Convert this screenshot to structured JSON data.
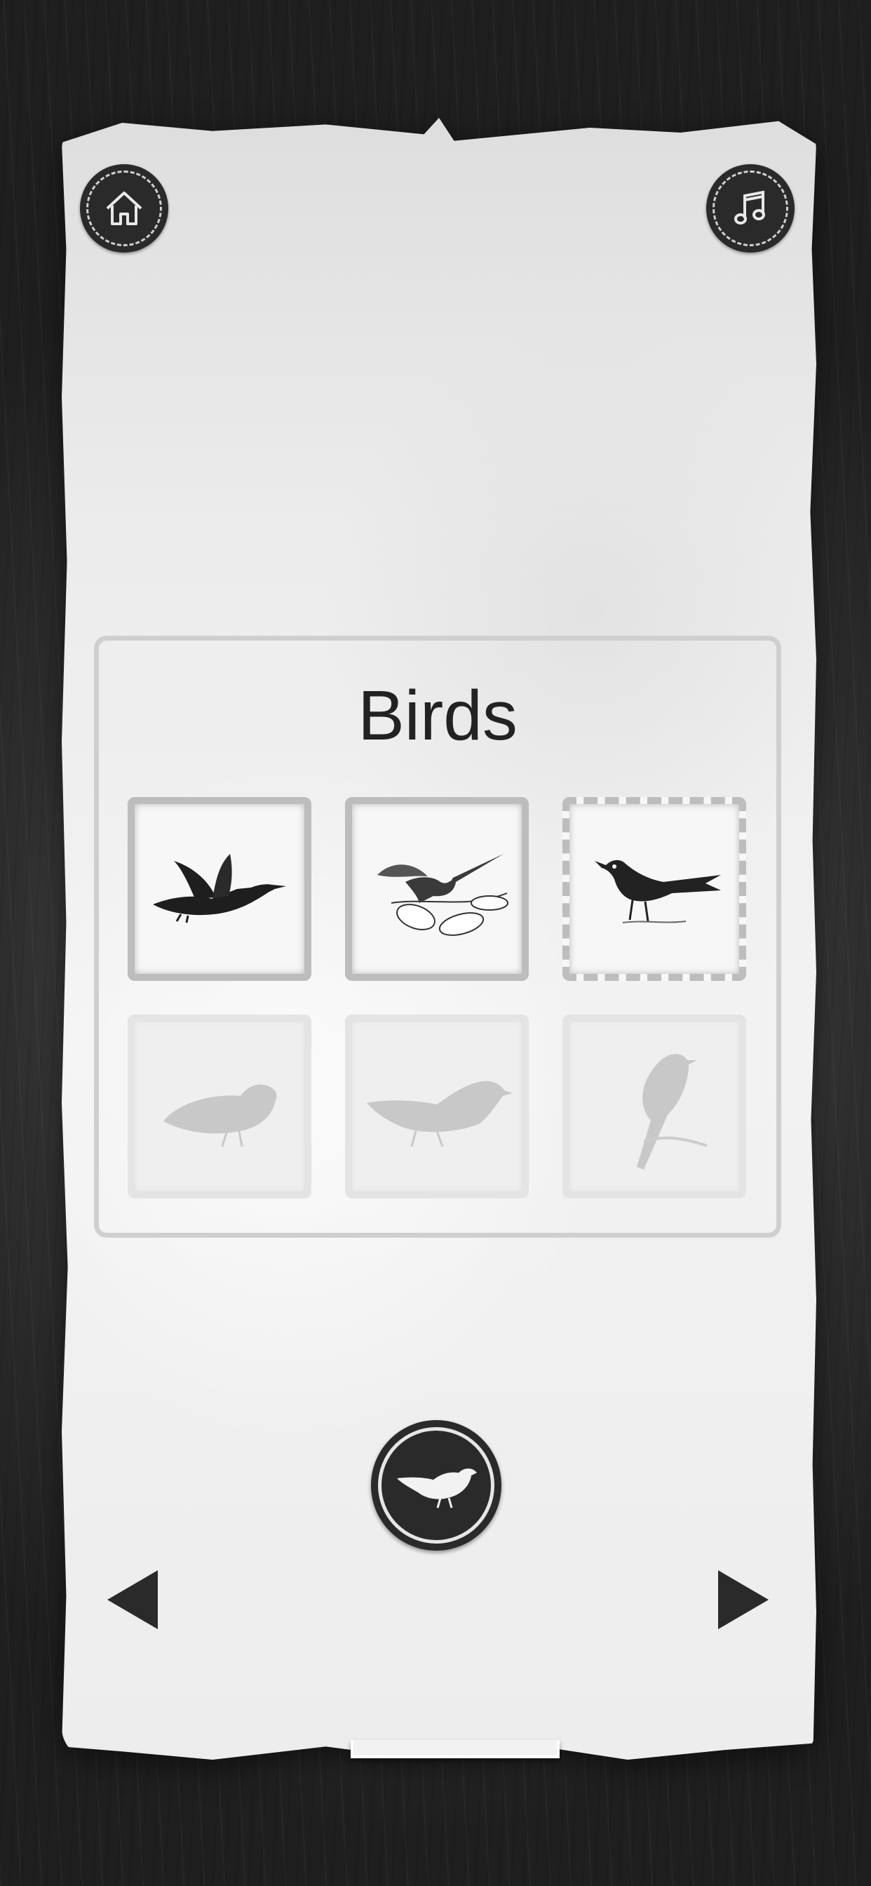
{
  "category": {
    "title": "Birds"
  },
  "header": {
    "home_icon": "home-icon",
    "music_icon": "music-note-icon"
  },
  "tiles": [
    {
      "name": "goose-flying",
      "state": "unlocked"
    },
    {
      "name": "hummingbird",
      "state": "unlocked"
    },
    {
      "name": "grackle",
      "state": "selected"
    },
    {
      "name": "partridge",
      "state": "locked"
    },
    {
      "name": "duck",
      "state": "locked"
    },
    {
      "name": "songbird-perched",
      "state": "locked"
    }
  ],
  "controls": {
    "sound_icon": "bird-silhouette-icon",
    "prev_icon": "triangle-left-icon",
    "next_icon": "triangle-right-icon"
  },
  "colors": {
    "button_dark": "#2a2a2a",
    "paper": "#efefef",
    "tile_border": "#bdbdbd",
    "panel_border": "#cfcfcf"
  }
}
